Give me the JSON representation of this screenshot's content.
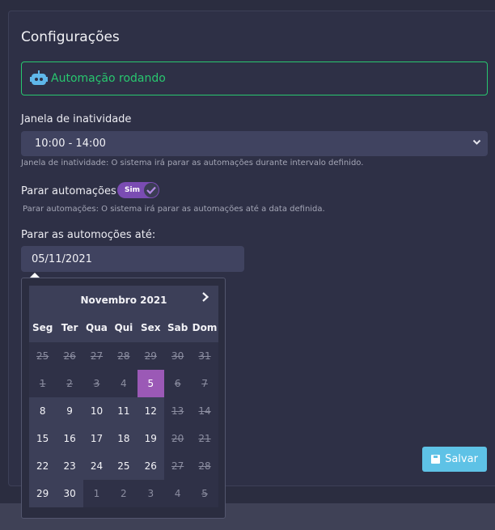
{
  "title": "Configurações",
  "status": {
    "text": "Automação rodando",
    "icon": "robot-icon",
    "color": "#28c76f"
  },
  "inactivity": {
    "label": "Janela de inatividade",
    "value": "10:00 - 14:00",
    "help": "Janela de inatividade: O sistema irá parar as automações durante intervalo definido."
  },
  "stop": {
    "label": "Parar automações",
    "toggle_label": "Sim",
    "help": "Parar automações: O sistema irá parar as automações até a data definida."
  },
  "until": {
    "label": "Parar as automoções até:",
    "value": "05/11/2021"
  },
  "calendar": {
    "month_label": "Novembro 2021",
    "weekdays": [
      "Seg",
      "Ter",
      "Qua",
      "Qui",
      "Sex",
      "Sab",
      "Dom"
    ],
    "days": [
      {
        "d": "25",
        "s": "disabled"
      },
      {
        "d": "26",
        "s": "disabled"
      },
      {
        "d": "27",
        "s": "disabled"
      },
      {
        "d": "28",
        "s": "disabled"
      },
      {
        "d": "29",
        "s": "disabled"
      },
      {
        "d": "30",
        "s": "disabled"
      },
      {
        "d": "31",
        "s": "disabled"
      },
      {
        "d": "1",
        "s": "disabled"
      },
      {
        "d": "2",
        "s": "disabled"
      },
      {
        "d": "3",
        "s": "disabled"
      },
      {
        "d": "4",
        "s": "other"
      },
      {
        "d": "5",
        "s": "selected"
      },
      {
        "d": "6",
        "s": "disabled"
      },
      {
        "d": "7",
        "s": "disabled"
      },
      {
        "d": "8",
        "s": "enabled"
      },
      {
        "d": "9",
        "s": "enabled"
      },
      {
        "d": "10",
        "s": "enabled"
      },
      {
        "d": "11",
        "s": "enabled"
      },
      {
        "d": "12",
        "s": "enabled"
      },
      {
        "d": "13",
        "s": "disabled"
      },
      {
        "d": "14",
        "s": "disabled"
      },
      {
        "d": "15",
        "s": "enabled"
      },
      {
        "d": "16",
        "s": "enabled"
      },
      {
        "d": "17",
        "s": "enabled"
      },
      {
        "d": "18",
        "s": "enabled"
      },
      {
        "d": "19",
        "s": "enabled"
      },
      {
        "d": "20",
        "s": "disabled"
      },
      {
        "d": "21",
        "s": "disabled"
      },
      {
        "d": "22",
        "s": "enabled"
      },
      {
        "d": "23",
        "s": "enabled"
      },
      {
        "d": "24",
        "s": "enabled"
      },
      {
        "d": "25",
        "s": "enabled"
      },
      {
        "d": "26",
        "s": "enabled"
      },
      {
        "d": "27",
        "s": "disabled"
      },
      {
        "d": "28",
        "s": "disabled"
      },
      {
        "d": "29",
        "s": "enabled"
      },
      {
        "d": "30",
        "s": "enabled"
      },
      {
        "d": "1",
        "s": "other"
      },
      {
        "d": "2",
        "s": "other"
      },
      {
        "d": "3",
        "s": "other"
      },
      {
        "d": "4",
        "s": "other"
      },
      {
        "d": "5",
        "s": "disabled"
      }
    ]
  },
  "save_button": {
    "label": "Salvar",
    "icon": "save-icon",
    "color": "#5ec2e6"
  }
}
